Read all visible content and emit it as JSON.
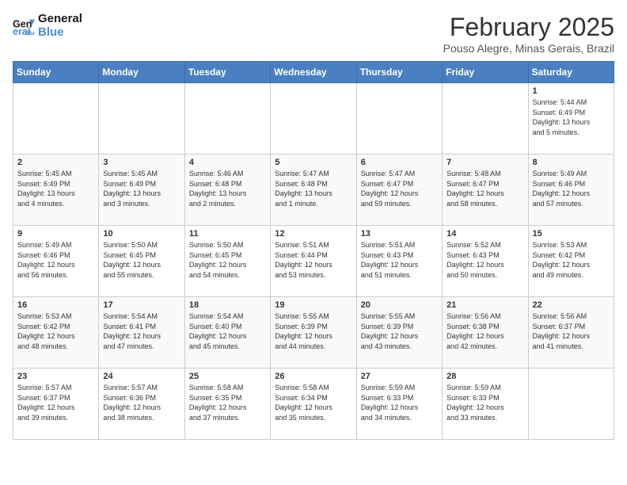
{
  "header": {
    "logo_general": "General",
    "logo_blue": "Blue",
    "month_year": "February 2025",
    "location": "Pouso Alegre, Minas Gerais, Brazil"
  },
  "weekdays": [
    "Sunday",
    "Monday",
    "Tuesday",
    "Wednesday",
    "Thursday",
    "Friday",
    "Saturday"
  ],
  "weeks": [
    [
      {
        "day": "",
        "info": ""
      },
      {
        "day": "",
        "info": ""
      },
      {
        "day": "",
        "info": ""
      },
      {
        "day": "",
        "info": ""
      },
      {
        "day": "",
        "info": ""
      },
      {
        "day": "",
        "info": ""
      },
      {
        "day": "1",
        "info": "Sunrise: 5:44 AM\nSunset: 6:49 PM\nDaylight: 13 hours\nand 5 minutes."
      }
    ],
    [
      {
        "day": "2",
        "info": "Sunrise: 5:45 AM\nSunset: 6:49 PM\nDaylight: 13 hours\nand 4 minutes."
      },
      {
        "day": "3",
        "info": "Sunrise: 5:45 AM\nSunset: 6:49 PM\nDaylight: 13 hours\nand 3 minutes."
      },
      {
        "day": "4",
        "info": "Sunrise: 5:46 AM\nSunset: 6:48 PM\nDaylight: 13 hours\nand 2 minutes."
      },
      {
        "day": "5",
        "info": "Sunrise: 5:47 AM\nSunset: 6:48 PM\nDaylight: 13 hours\nand 1 minute."
      },
      {
        "day": "6",
        "info": "Sunrise: 5:47 AM\nSunset: 6:47 PM\nDaylight: 12 hours\nand 59 minutes."
      },
      {
        "day": "7",
        "info": "Sunrise: 5:48 AM\nSunset: 6:47 PM\nDaylight: 12 hours\nand 58 minutes."
      },
      {
        "day": "8",
        "info": "Sunrise: 5:49 AM\nSunset: 6:46 PM\nDaylight: 12 hours\nand 57 minutes."
      }
    ],
    [
      {
        "day": "9",
        "info": "Sunrise: 5:49 AM\nSunset: 6:46 PM\nDaylight: 12 hours\nand 56 minutes."
      },
      {
        "day": "10",
        "info": "Sunrise: 5:50 AM\nSunset: 6:45 PM\nDaylight: 12 hours\nand 55 minutes."
      },
      {
        "day": "11",
        "info": "Sunrise: 5:50 AM\nSunset: 6:45 PM\nDaylight: 12 hours\nand 54 minutes."
      },
      {
        "day": "12",
        "info": "Sunrise: 5:51 AM\nSunset: 6:44 PM\nDaylight: 12 hours\nand 53 minutes."
      },
      {
        "day": "13",
        "info": "Sunrise: 5:51 AM\nSunset: 6:43 PM\nDaylight: 12 hours\nand 51 minutes."
      },
      {
        "day": "14",
        "info": "Sunrise: 5:52 AM\nSunset: 6:43 PM\nDaylight: 12 hours\nand 50 minutes."
      },
      {
        "day": "15",
        "info": "Sunrise: 5:53 AM\nSunset: 6:42 PM\nDaylight: 12 hours\nand 49 minutes."
      }
    ],
    [
      {
        "day": "16",
        "info": "Sunrise: 5:53 AM\nSunset: 6:42 PM\nDaylight: 12 hours\nand 48 minutes."
      },
      {
        "day": "17",
        "info": "Sunrise: 5:54 AM\nSunset: 6:41 PM\nDaylight: 12 hours\nand 47 minutes."
      },
      {
        "day": "18",
        "info": "Sunrise: 5:54 AM\nSunset: 6:40 PM\nDaylight: 12 hours\nand 45 minutes."
      },
      {
        "day": "19",
        "info": "Sunrise: 5:55 AM\nSunset: 6:39 PM\nDaylight: 12 hours\nand 44 minutes."
      },
      {
        "day": "20",
        "info": "Sunrise: 5:55 AM\nSunset: 6:39 PM\nDaylight: 12 hours\nand 43 minutes."
      },
      {
        "day": "21",
        "info": "Sunrise: 5:56 AM\nSunset: 6:38 PM\nDaylight: 12 hours\nand 42 minutes."
      },
      {
        "day": "22",
        "info": "Sunrise: 5:56 AM\nSunset: 6:37 PM\nDaylight: 12 hours\nand 41 minutes."
      }
    ],
    [
      {
        "day": "23",
        "info": "Sunrise: 5:57 AM\nSunset: 6:37 PM\nDaylight: 12 hours\nand 39 minutes."
      },
      {
        "day": "24",
        "info": "Sunrise: 5:57 AM\nSunset: 6:36 PM\nDaylight: 12 hours\nand 38 minutes."
      },
      {
        "day": "25",
        "info": "Sunrise: 5:58 AM\nSunset: 6:35 PM\nDaylight: 12 hours\nand 37 minutes."
      },
      {
        "day": "26",
        "info": "Sunrise: 5:58 AM\nSunset: 6:34 PM\nDaylight: 12 hours\nand 35 minutes."
      },
      {
        "day": "27",
        "info": "Sunrise: 5:59 AM\nSunset: 6:33 PM\nDaylight: 12 hours\nand 34 minutes."
      },
      {
        "day": "28",
        "info": "Sunrise: 5:59 AM\nSunset: 6:33 PM\nDaylight: 12 hours\nand 33 minutes."
      },
      {
        "day": "",
        "info": ""
      }
    ]
  ]
}
